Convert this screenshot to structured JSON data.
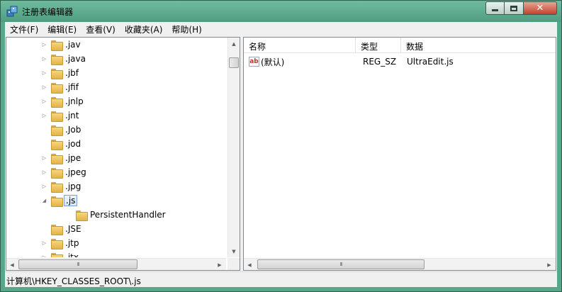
{
  "window": {
    "title": "注册表编辑器",
    "close_glyph": "✕",
    "icon": "regedit-icon"
  },
  "menu": {
    "items": [
      "文件(F)",
      "编辑(E)",
      "查看(V)",
      "收藏夹(A)",
      "帮助(H)"
    ]
  },
  "tree": {
    "items": [
      {
        "label": ".jav",
        "expander": "▷",
        "selected": false
      },
      {
        "label": ".java",
        "expander": "▷",
        "selected": false
      },
      {
        "label": ".jbf",
        "expander": "▷",
        "selected": false
      },
      {
        "label": ".jfif",
        "expander": "▷",
        "selected": false
      },
      {
        "label": ".jnlp",
        "expander": "▷",
        "selected": false
      },
      {
        "label": ".jnt",
        "expander": "▷",
        "selected": false
      },
      {
        "label": ".Job",
        "expander": "",
        "selected": false
      },
      {
        "label": ".jod",
        "expander": "",
        "selected": false
      },
      {
        "label": ".jpe",
        "expander": "▷",
        "selected": false
      },
      {
        "label": ".jpeg",
        "expander": "▷",
        "selected": false
      },
      {
        "label": ".jpg",
        "expander": "▷",
        "selected": false
      },
      {
        "label": ".js",
        "expander": "◢",
        "selected": true
      },
      {
        "label": "PersistentHandler",
        "expander": "",
        "selected": false,
        "child": true
      },
      {
        "label": ".JSE",
        "expander": "",
        "selected": false
      },
      {
        "label": ".jtp",
        "expander": "▷",
        "selected": false
      },
      {
        "label": ".jtx",
        "expander": "▷",
        "selected": false
      }
    ]
  },
  "values_list": {
    "columns": [
      "名称",
      "类型",
      "数据"
    ],
    "rows": [
      {
        "name": "(默认)",
        "type": "REG_SZ",
        "data": "UltraEdit.js",
        "icon_text": "ab"
      }
    ]
  },
  "scroll": {
    "up": "▲",
    "down": "▼",
    "left": "◀",
    "right": "▶",
    "grip": "III"
  },
  "status": {
    "path": "计算机\\HKEY_CLASSES_ROOT\\.js"
  }
}
